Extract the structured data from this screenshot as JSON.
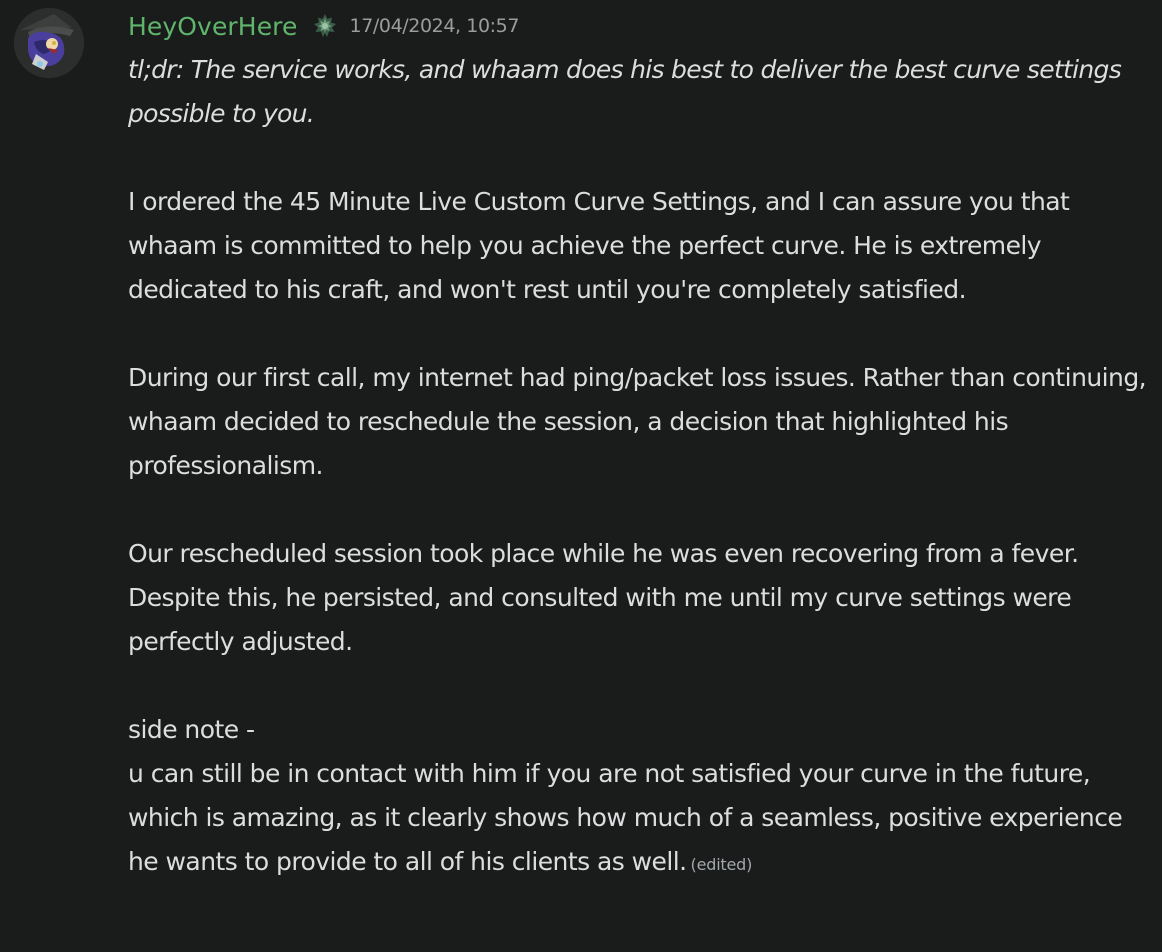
{
  "message": {
    "author": "HeyOverHere",
    "timestamp": "17/04/2024, 10:57",
    "author_color": "#5fb56b",
    "role_icon": "sprout-badge-icon",
    "paragraphs": {
      "tldr": "tl;dr: The service works, and whaam does his best to deliver the best curve settings possible to you.",
      "p1": "I ordered the 45 Minute Live Custom Curve Settings, and I can assure you that whaam is committed to help you achieve the perfect curve. He is extremely dedicated to his craft, and won't rest until you're completely satisfied.",
      "p2": "During our first call, my internet had ping/packet loss issues. Rather than continuing, whaam decided to reschedule the session, a decision that highlighted his professionalism.",
      "p3": "Our rescheduled session took place while he was even recovering from a fever. Despite this, he persisted, and consulted with me until my curve settings were perfectly adjusted.",
      "p4_line1": "side note -",
      "p4_line2": "u can still be in contact with him if you are not satisfied your curve in the future, which is amazing, as it clearly shows how much of a seamless, positive experience he wants to provide to all of his clients as well."
    },
    "edited_label": "(edited)"
  }
}
